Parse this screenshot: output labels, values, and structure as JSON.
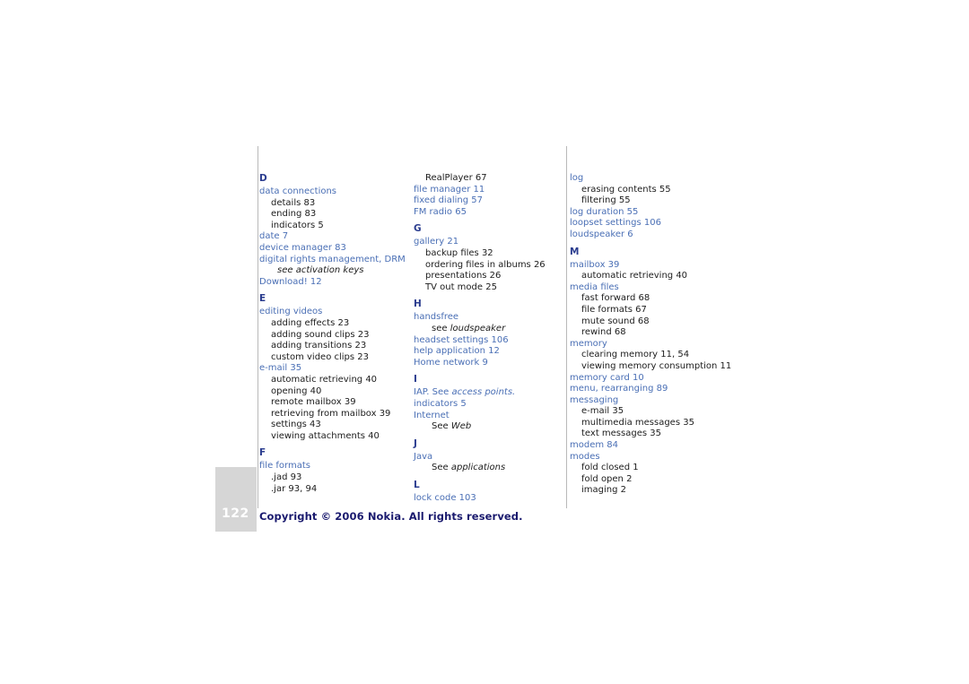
{
  "page": {
    "number": "122",
    "copyright": "Copyright © 2006 Nokia. All rights reserved."
  },
  "columns": [
    {
      "id": "column-1",
      "blocks": [
        {
          "type": "letter",
          "text": "D"
        },
        {
          "type": "entry",
          "text": "data connections"
        },
        {
          "type": "sub",
          "text": "details 83"
        },
        {
          "type": "sub",
          "text": "ending 83"
        },
        {
          "type": "sub",
          "text": "indicators 5"
        },
        {
          "type": "entry",
          "text": "date 7"
        },
        {
          "type": "entry",
          "text": "device manager 83"
        },
        {
          "type": "entry",
          "text": "digital rights management, DRM"
        },
        {
          "type": "sub-italic",
          "text": "see activation keys"
        },
        {
          "type": "entry",
          "text": "Download! 12"
        },
        {
          "type": "letter",
          "text": "E"
        },
        {
          "type": "entry",
          "text": "editing videos"
        },
        {
          "type": "sub",
          "text": "adding effects 23"
        },
        {
          "type": "sub",
          "text": "adding sound clips 23"
        },
        {
          "type": "sub",
          "text": "adding transitions 23"
        },
        {
          "type": "sub",
          "text": "custom video clips 23"
        },
        {
          "type": "entry",
          "text": "e-mail 35"
        },
        {
          "type": "sub",
          "text": "automatic retrieving 40"
        },
        {
          "type": "sub",
          "text": "opening 40"
        },
        {
          "type": "sub",
          "text": "remote mailbox 39"
        },
        {
          "type": "sub",
          "text": "retrieving from mailbox 39"
        },
        {
          "type": "sub",
          "text": "settings 43"
        },
        {
          "type": "sub",
          "text": "viewing attachments 40"
        },
        {
          "type": "letter",
          "text": "F"
        },
        {
          "type": "entry",
          "text": "file formats"
        },
        {
          "type": "sub",
          "text": ".jad 93"
        },
        {
          "type": "sub",
          "text": ".jar 93, 94"
        }
      ]
    },
    {
      "id": "column-2",
      "blocks": [
        {
          "type": "sub",
          "text": "RealPlayer 67"
        },
        {
          "type": "entry",
          "text": "file manager 11"
        },
        {
          "type": "entry",
          "text": "fixed dialing 57"
        },
        {
          "type": "entry",
          "text": "FM radio 65"
        },
        {
          "type": "letter",
          "text": "G"
        },
        {
          "type": "entry",
          "text": "gallery 21"
        },
        {
          "type": "sub",
          "text": "backup files 32"
        },
        {
          "type": "sub",
          "text": "ordering files in albums 26"
        },
        {
          "type": "sub",
          "text": "presentations 26"
        },
        {
          "type": "sub",
          "text": "TV out mode 25"
        },
        {
          "type": "letter",
          "text": "H"
        },
        {
          "type": "entry",
          "text": "handsfree"
        },
        {
          "type": "sub-see",
          "text": "see ",
          "italic": "loudspeaker"
        },
        {
          "type": "entry",
          "text": "headset settings 106"
        },
        {
          "type": "entry",
          "text": "help application 12"
        },
        {
          "type": "entry",
          "text": "Home network 9"
        },
        {
          "type": "letter",
          "text": "I"
        },
        {
          "type": "entry-see",
          "text": "IAP. See ",
          "italic": "access points."
        },
        {
          "type": "entry",
          "text": "indicators 5"
        },
        {
          "type": "entry",
          "text": "Internet"
        },
        {
          "type": "sub-see",
          "text": "See ",
          "italic": "Web"
        },
        {
          "type": "letter",
          "text": "J"
        },
        {
          "type": "entry",
          "text": "Java"
        },
        {
          "type": "sub-see",
          "text": "See ",
          "italic": "applications"
        },
        {
          "type": "letter",
          "text": "L"
        },
        {
          "type": "entry",
          "text": "lock code 103"
        }
      ]
    },
    {
      "id": "column-3",
      "blocks": [
        {
          "type": "entry",
          "text": "log"
        },
        {
          "type": "sub",
          "text": "erasing contents 55"
        },
        {
          "type": "sub",
          "text": "filtering 55"
        },
        {
          "type": "entry",
          "text": "log duration 55"
        },
        {
          "type": "entry",
          "text": "loopset settings 106"
        },
        {
          "type": "entry",
          "text": "loudspeaker 6"
        },
        {
          "type": "letter",
          "text": "M"
        },
        {
          "type": "entry",
          "text": "mailbox 39"
        },
        {
          "type": "sub",
          "text": "automatic retrieving 40"
        },
        {
          "type": "entry",
          "text": "media files"
        },
        {
          "type": "sub",
          "text": "fast forward 68"
        },
        {
          "type": "sub",
          "text": "file formats 67"
        },
        {
          "type": "sub",
          "text": "mute sound 68"
        },
        {
          "type": "sub",
          "text": "rewind 68"
        },
        {
          "type": "entry",
          "text": "memory"
        },
        {
          "type": "sub",
          "text": "clearing memory 11, 54"
        },
        {
          "type": "sub",
          "text": "viewing memory consumption 11"
        },
        {
          "type": "entry",
          "text": "memory card 10"
        },
        {
          "type": "entry",
          "text": "menu, rearranging 89"
        },
        {
          "type": "entry",
          "text": "messaging"
        },
        {
          "type": "sub",
          "text": "e-mail 35"
        },
        {
          "type": "sub",
          "text": "multimedia messages 35"
        },
        {
          "type": "sub",
          "text": "text messages 35"
        },
        {
          "type": "entry",
          "text": "modem 84"
        },
        {
          "type": "entry",
          "text": "modes"
        },
        {
          "type": "sub",
          "text": "fold closed 1"
        },
        {
          "type": "sub",
          "text": "fold open 2"
        },
        {
          "type": "sub",
          "text": "imaging 2"
        }
      ]
    }
  ]
}
